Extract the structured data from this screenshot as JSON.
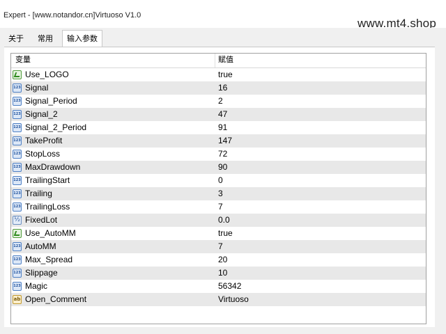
{
  "window": {
    "title": "Expert - [www.notandor.cn]Virtuoso V1.0",
    "watermark": "www.mt4.shop"
  },
  "tabs": [
    {
      "label": "关于",
      "active": false
    },
    {
      "label": "常用",
      "active": false
    },
    {
      "label": "输入参数",
      "active": true
    }
  ],
  "table": {
    "columns": [
      "变量",
      "赋值"
    ],
    "rows": [
      {
        "name": "Use_LOGO",
        "value": "true",
        "type": "bool-icon"
      },
      {
        "name": "Signal",
        "value": "16",
        "type": "int-icon"
      },
      {
        "name": "Signal_Period",
        "value": "2",
        "type": "int-icon"
      },
      {
        "name": "Signal_2",
        "value": "47",
        "type": "int-icon"
      },
      {
        "name": "Signal_2_Period",
        "value": "91",
        "type": "int-icon"
      },
      {
        "name": "TakeProfit",
        "value": "147",
        "type": "int-icon"
      },
      {
        "name": "StopLoss",
        "value": "72",
        "type": "int-icon"
      },
      {
        "name": "MaxDrawdown",
        "value": "90",
        "type": "int-icon"
      },
      {
        "name": "TrailingStart",
        "value": "0",
        "type": "int-icon"
      },
      {
        "name": "Trailing",
        "value": "3",
        "type": "int-icon"
      },
      {
        "name": "TrailingLoss",
        "value": "7",
        "type": "int-icon"
      },
      {
        "name": "FixedLot",
        "value": "0.0",
        "type": "double-icon"
      },
      {
        "name": "Use_AutoMM",
        "value": "true",
        "type": "bool-icon"
      },
      {
        "name": "AutoMM",
        "value": "7",
        "type": "int-icon"
      },
      {
        "name": "Max_Spread",
        "value": "20",
        "type": "int-icon"
      },
      {
        "name": "Slippage",
        "value": "10",
        "type": "int-icon"
      },
      {
        "name": "Magic",
        "value": "56342",
        "type": "int-icon"
      },
      {
        "name": "Open_Comment",
        "value": "Virtuoso",
        "type": "string-icon"
      }
    ]
  }
}
